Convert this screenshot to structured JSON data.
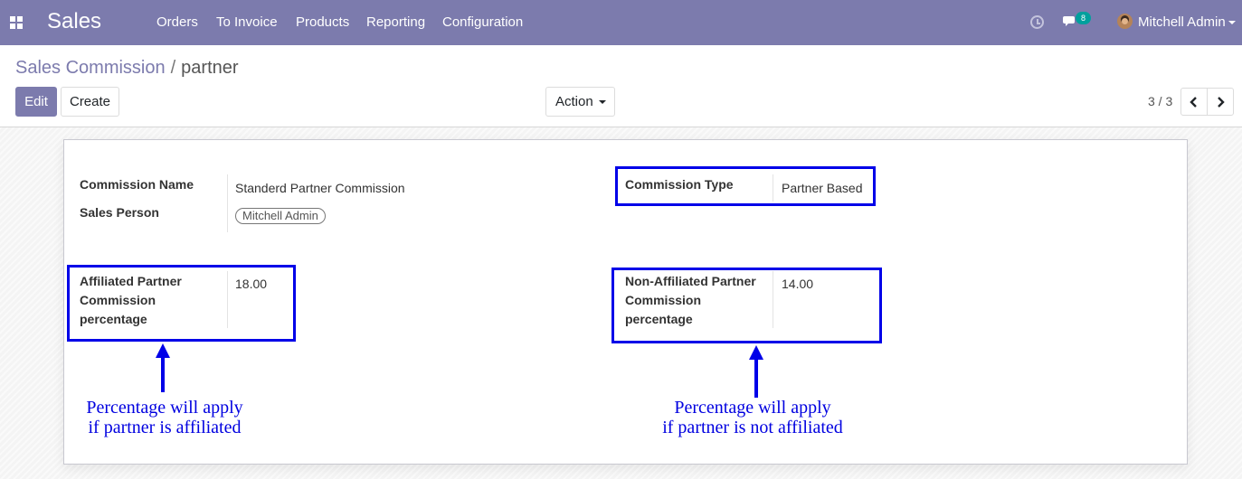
{
  "navbar": {
    "app_title": "Sales",
    "menu": [
      "Orders",
      "To Invoice",
      "Products",
      "Reporting",
      "Configuration"
    ],
    "chat_count": "8",
    "user_name": "Mitchell Admin",
    "background_color": "#7c7bad"
  },
  "breadcrumb": {
    "parent": "Sales Commission",
    "separator": "/",
    "current": "partner"
  },
  "toolbar": {
    "edit_label": "Edit",
    "create_label": "Create",
    "action_label": "Action"
  },
  "pager": {
    "value": "3 / 3"
  },
  "form": {
    "commission_name": {
      "label": "Commission Name",
      "value": "Standerd Partner Commission"
    },
    "sales_person": {
      "label": "Sales Person",
      "value": "Mitchell Admin"
    },
    "commission_type": {
      "label": "Commission Type",
      "value": "Partner Based"
    },
    "affiliated": {
      "label": "Affiliated Partner Commission percentage",
      "value": "18.00"
    },
    "non_affiliated": {
      "label": "Non-Affiliated Partner Commission percentage",
      "value": "14.00"
    }
  },
  "annotations": {
    "left": [
      "Percentage will apply",
      "if partner is affiliated"
    ],
    "right": [
      "Percentage will apply",
      "if partner is not affiliated"
    ],
    "highlight_color": "#0000e8"
  },
  "icons": [
    "apps-icon",
    "clock-icon",
    "chat-icon",
    "chevron-left-icon",
    "chevron-right-icon",
    "caret-down-icon"
  ]
}
